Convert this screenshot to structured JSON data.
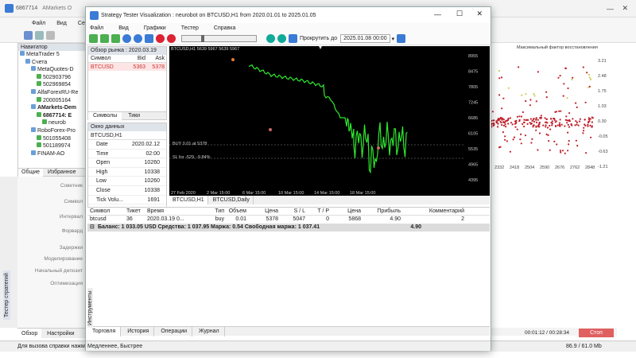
{
  "main_window": {
    "title_account": "6867714",
    "title_rest": "AMarkets O",
    "menu": [
      "Файл",
      "Вид",
      "Серв"
    ],
    "navigator": {
      "header": "Навигатор",
      "items": [
        {
          "label": "MetaTrader 5",
          "indent": 0,
          "bold": false
        },
        {
          "label": "Счета",
          "indent": 1,
          "bold": false
        },
        {
          "label": "MetaQuotes-D",
          "indent": 2,
          "bold": false
        },
        {
          "label": "502903796",
          "indent": 3,
          "bold": false
        },
        {
          "label": "502969854",
          "indent": 3,
          "bold": false
        },
        {
          "label": "AlfaForexRU-Re",
          "indent": 2,
          "bold": false
        },
        {
          "label": "200005164",
          "indent": 3,
          "bold": false
        },
        {
          "label": "AMarkets-Dem",
          "indent": 2,
          "bold": true
        },
        {
          "label": "6867714: E",
          "indent": 3,
          "bold": true
        },
        {
          "label": "neurob",
          "indent": 4,
          "bold": false
        },
        {
          "label": "RoboForex-Pro",
          "indent": 2,
          "bold": false
        },
        {
          "label": "501055408",
          "indent": 3,
          "bold": false
        },
        {
          "label": "501189974",
          "indent": 3,
          "bold": false
        },
        {
          "label": "FINAM-AO",
          "indent": 2,
          "bold": false
        }
      ],
      "tabs": [
        "Общие",
        "Избранное"
      ]
    },
    "params": [
      "Советник",
      "Символ",
      "Интервал",
      "Форвард",
      "Задержки",
      "Моделирование",
      "Начальный депозит",
      "Оптимизация"
    ],
    "side_tabs": [
      "Тестер стратегий",
      "Инструменты"
    ],
    "bottom_tabs": [
      "Обзор",
      "Настройки"
    ],
    "status_left": "Для вызова справки нажм",
    "status_right": "86.9 / 61.0 Mb",
    "timer": "00:01:12 / 00:28:34",
    "stop_label": "Стоп",
    "right_chart": {
      "title": "Максимальный фактор восстановления",
      "yticks": [
        "3.21",
        "2.48",
        "1.75",
        "1.03",
        "0.30",
        "-0.05",
        "-0.63",
        "-1.21"
      ],
      "xticks": [
        "2332",
        "2418",
        "2504",
        "2590",
        "2676",
        "2762",
        "2848"
      ]
    }
  },
  "tester": {
    "title": "Strategy Tester Visualization : neurobot on BTCUSD,H1 from 2020.01.01 to 2025.01.05",
    "menu": [
      "Файл",
      "Вид",
      "Графики",
      "Тестер",
      "Справка"
    ],
    "scroll_label": "Прокрутить до",
    "scroll_value": "2025.01.08 00:00",
    "market_watch": {
      "header": "Обзор рынка : 2020.03.19",
      "columns": [
        "Символ",
        "Bid",
        "Ask"
      ],
      "rows": [
        {
          "symbol": "BTCUSD",
          "bid": "5363",
          "ask": "5378"
        }
      ],
      "tabs": [
        "Символы",
        "Тики"
      ]
    },
    "data_window": {
      "header": "Окно данных",
      "symbol": "BTCUSD,H1",
      "rows": [
        {
          "k": "Date",
          "v": "2020.02.12"
        },
        {
          "k": "Time",
          "v": "02:00"
        },
        {
          "k": "Open",
          "v": "10260"
        },
        {
          "k": "High",
          "v": "10338"
        },
        {
          "k": "Low",
          "v": "10260"
        },
        {
          "k": "Close",
          "v": "10338"
        },
        {
          "k": "Tick Volu...",
          "v": "1691"
        }
      ]
    },
    "chart": {
      "header": "BTCUSD,H1  5639 5967 5639 5967",
      "buy_label": "BUY 0.01 at 5378",
      "sl_label": "SL for -529, -9.84%",
      "price_ticks": [
        "8955",
        "8475",
        "7805",
        "7245",
        "6685",
        "6105",
        "5535",
        "4965",
        "4395"
      ],
      "time_ticks": [
        "27 Feb 2020",
        "2 Mar 15:00",
        "6 Mar 15:00",
        "10 Mar 15:00",
        "14 Mar 15:00",
        "18 Mar 15:00"
      ],
      "tabs": [
        "BTCUSD,H1",
        "BTCUSD,Daily"
      ]
    },
    "positions": {
      "columns": [
        "Символ",
        "Тикет",
        "Время",
        "Тип",
        "Объем",
        "Цена",
        "S / L",
        "T / P",
        "Цена",
        "Прибыль",
        "Комментарий"
      ],
      "row": [
        "btcusd",
        "36",
        "2020.03.19 0...",
        "buy",
        "0.01",
        "5378",
        "5047",
        "0",
        "5868",
        "4.90",
        "2"
      ],
      "balance_line": "Баланс: 1 033.05 USD  Средства: 1 037.95  Маржа: 0.54  Свободная маржа: 1 037.41",
      "balance_profit": "4.90"
    },
    "bottom_tabs": [
      "Торговля",
      "История",
      "Операции",
      "Журнал"
    ],
    "status": "Медленнее, Быстрее"
  }
}
